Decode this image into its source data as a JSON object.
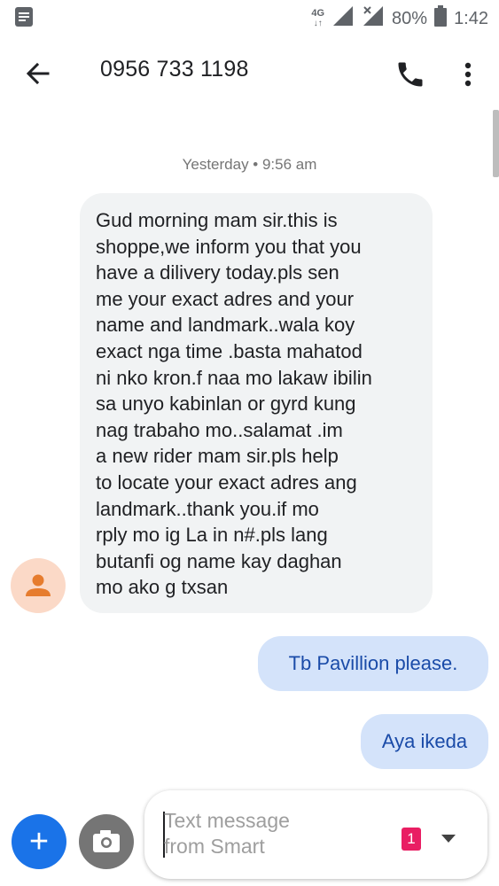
{
  "statusbar": {
    "notification_icon": "message-notification-icon",
    "network_label": "4G",
    "battery_percent": "80%",
    "time": "1:42"
  },
  "appbar": {
    "title": "0956 733 1198",
    "icons": [
      "back-arrow-icon",
      "phone-call-icon",
      "more-vert-icon"
    ]
  },
  "conversation": {
    "timestamp": "Yesterday • 9:56 am",
    "incoming_message": "Gud morning mam sir.this is\nshoppe,we inform you that you\nhave a dilivery today.pls sen\nme your exact adres and your\nname and landmark..wala koy\nexact nga time .basta mahatod\nni nko kron.f naa mo lakaw ibilin\nsa unyo kabinlan or gyrd kung\nnag trabaho mo..salamat .im\na new rider mam sir.pls help\nto locate your exact adres ang\nlandmark..thank you.if mo\nrply mo ig La in n#.pls lang\nbutanfi og name kay daghan\nmo ako g txsan",
    "outgoing_messages": [
      "Tb Pavillion please.",
      "Aya ikeda"
    ]
  },
  "compose": {
    "placeholder": "Text message\nfrom Smart",
    "sim_badge": "1",
    "add_label": "+"
  },
  "colors": {
    "accent": "#1a73e8",
    "incoming_bubble": "#f1f3f4",
    "outgoing_bubble": "#d4e3fa",
    "outgoing_text": "#1a4ba8",
    "avatar_bg": "#fbd9c7",
    "sim_badge": "#e91e63"
  }
}
